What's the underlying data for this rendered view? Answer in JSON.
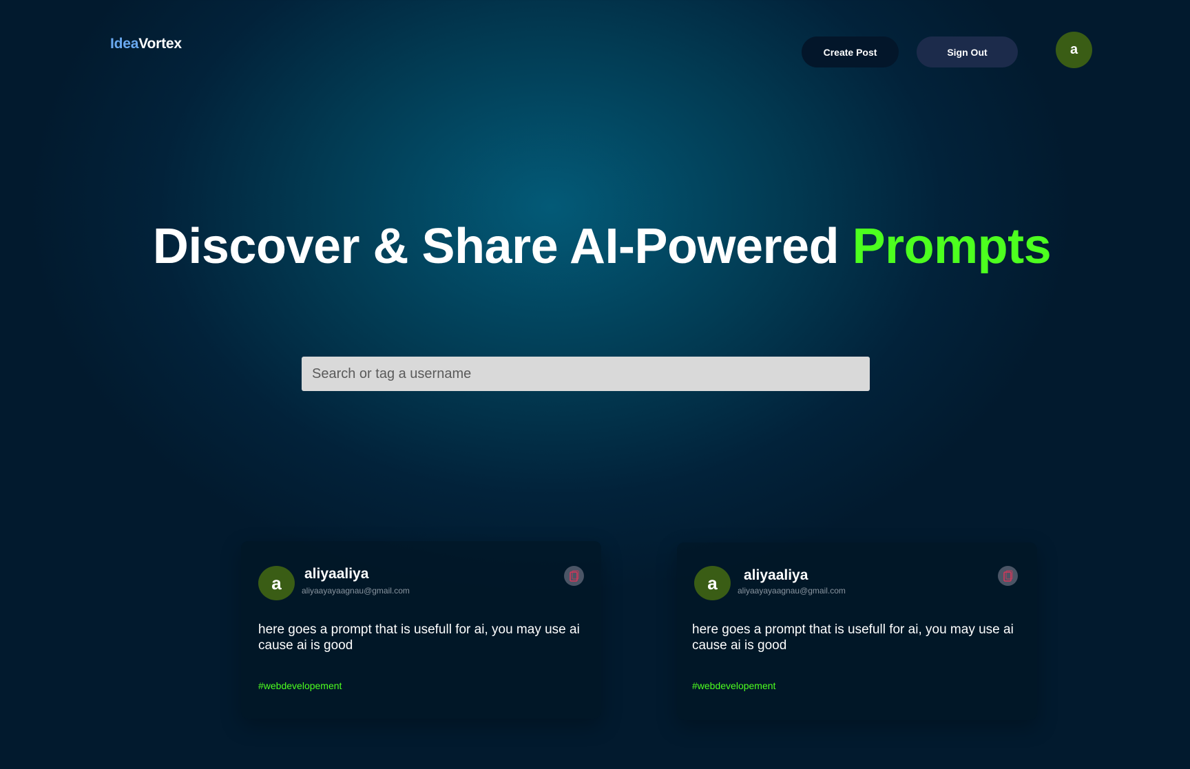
{
  "nav": {
    "logo_part1": "Idea",
    "logo_part2": "Vortex",
    "create_post_label": "Create Post",
    "sign_out_label": "Sign Out",
    "avatar_letter": "a"
  },
  "hero": {
    "title_main": "Discover & Share AI-Powered",
    "title_accent": "Prompts"
  },
  "search": {
    "placeholder": "Search or tag a username",
    "value": ""
  },
  "posts": [
    {
      "avatar_letter": "a",
      "username": "aliyaaliya",
      "email": "aliyaayayaagnau@gmail.com",
      "prompt": "here goes a prompt that is usefull for ai, you may use ai cause ai is good",
      "tag": "#webdevelopement",
      "copy_icon": "copy-icon"
    },
    {
      "avatar_letter": "a",
      "username": "aliyaaliya",
      "email": "aliyaayayaagnau@gmail.com",
      "prompt": "here goes a prompt that is usefull for ai, you may use ai cause ai is good",
      "tag": "#webdevelopement",
      "copy_icon": "copy-icon"
    }
  ],
  "colors": {
    "accent_green": "#4dff1f",
    "logo_blue": "#6aa9f0",
    "avatar_green": "#3a5d15",
    "copy_icon_red": "#d6375a"
  }
}
